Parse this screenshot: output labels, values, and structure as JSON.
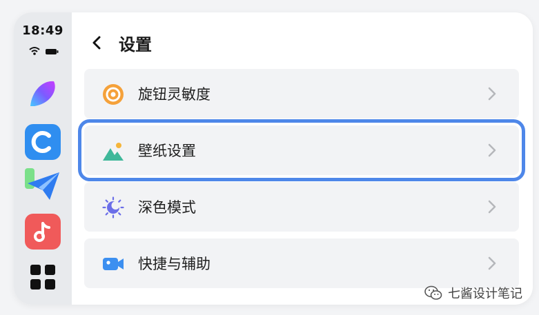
{
  "status": {
    "time": "18:49"
  },
  "dock": {
    "apps": [
      {
        "name": "feather-app-icon"
      },
      {
        "name": "c-app-icon"
      },
      {
        "name": "paper-plane-app-icon"
      },
      {
        "name": "music-app-icon"
      },
      {
        "name": "app-grid-icon"
      }
    ]
  },
  "header": {
    "title": "设置"
  },
  "settings": {
    "items": [
      {
        "label": "旋钮灵敏度",
        "icon": "knob-icon",
        "color": "#f5a13a"
      },
      {
        "label": "壁纸设置",
        "icon": "wallpaper-icon",
        "color": "#3fb89a",
        "selected": true
      },
      {
        "label": "深色模式",
        "icon": "dark-mode-icon",
        "color": "#6b6ee8"
      },
      {
        "label": "快捷与辅助",
        "icon": "shortcut-camera-icon",
        "color": "#3c8ff0"
      }
    ]
  },
  "watermark": {
    "text": "七酱设计笔记"
  },
  "colors": {
    "selection": "#4e87e9",
    "row_bg": "#f2f3f5",
    "sidebar_bg": "#e8eaed"
  }
}
